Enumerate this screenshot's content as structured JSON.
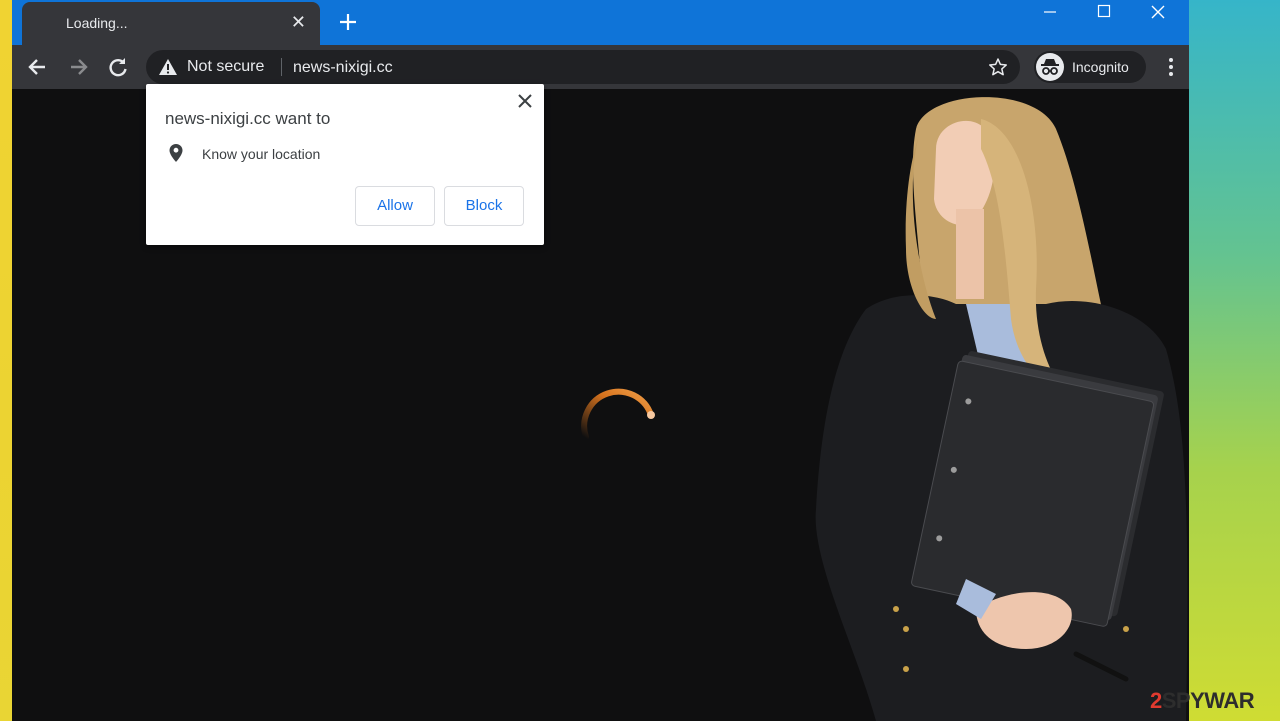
{
  "tab": {
    "title": "Loading..."
  },
  "omnibox": {
    "security_label": "Not secure",
    "url": "news-nixigi.cc"
  },
  "profile": {
    "label": "Incognito"
  },
  "permission_popup": {
    "title": "news-nixigi.cc want to",
    "permission": "Know your location",
    "allow_label": "Allow",
    "block_label": "Block"
  },
  "watermark": {
    "prefix": "2",
    "rest": "SPYWAR"
  },
  "colors": {
    "titlebar": "#0f74d8",
    "toolbar": "#35363a",
    "page_bg": "#0f0f10",
    "spinner": "#e58a2a",
    "button_text": "#1a73e8"
  }
}
